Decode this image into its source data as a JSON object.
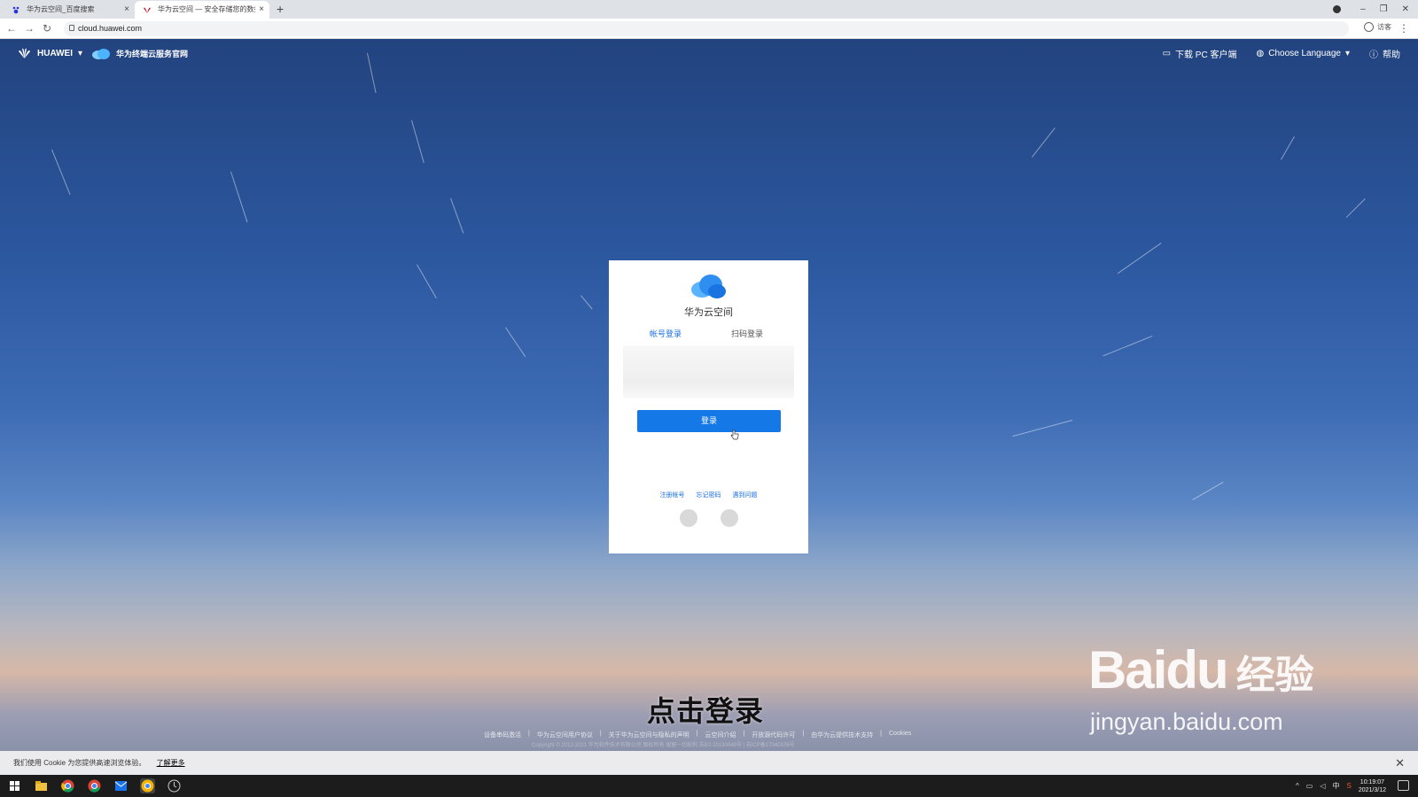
{
  "browser": {
    "tabs": [
      {
        "label": "华为云空间_百度搜索",
        "active": false
      },
      {
        "label": "华为云空间 — 安全存储您的数据",
        "active": true
      }
    ],
    "new_tab": "+",
    "close_glyph": "×",
    "url": "cloud.huawei.com",
    "guest_label": "访客",
    "window_controls": [
      "–",
      "❐",
      "✕"
    ]
  },
  "site_header": {
    "brand": "HUAWEI",
    "site_name": "华为终端云服务官网",
    "download_client": "下载 PC 客户端",
    "language": "Choose Language",
    "help": "帮助"
  },
  "login_card": {
    "title": "华为云空间",
    "tab_account": "帐号登录",
    "tab_qr": "扫码登录",
    "login_button": "登录",
    "links": [
      "注册帐号",
      "忘记密码",
      "遇到问题"
    ]
  },
  "subtitle": "点击登录",
  "footer": {
    "links": [
      "设备串码激活",
      "华为云空间用户协议",
      "关于华为云空间与隐私的声明",
      "云空间介绍",
      "开放源代码许可",
      "由华为云提供技术支持",
      "Cookies"
    ],
    "copyright": "Copyright © 2012-2021 华为软件技术有限公司 版权所有 保留一切权利 苏B2-20130048号 | 苏ICP备17040376号"
  },
  "cookie_bar": {
    "text": "我们使用 Cookie 为您提供高速浏览体验。",
    "more": "了解更多",
    "close": "✕"
  },
  "watermark": {
    "brand": "Bai",
    "du": "du",
    "jingyan": "经验",
    "url": "jingyan.baidu.com"
  },
  "taskbar": {
    "time": "10:19:07",
    "date": "2021/3/12",
    "ime": "中"
  },
  "colors": {
    "accent": "#1478e6",
    "link": "#1a6fe0"
  }
}
